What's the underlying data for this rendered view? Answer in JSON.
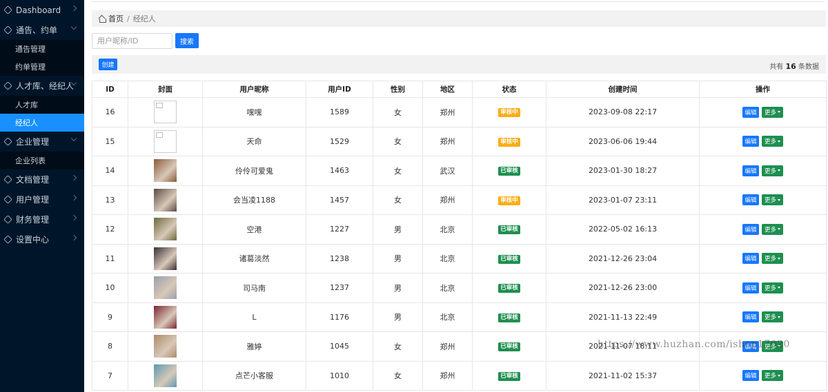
{
  "sidebar": {
    "items": [
      {
        "label": "Dashboard",
        "expanded": false,
        "children": []
      },
      {
        "label": "通告、约单",
        "expanded": true,
        "children": [
          {
            "label": "通告管理",
            "active": false
          },
          {
            "label": "约单管理",
            "active": false
          }
        ]
      },
      {
        "label": "人才库、经纪人",
        "expanded": true,
        "children": [
          {
            "label": "人才库",
            "active": false
          },
          {
            "label": "经纪人",
            "active": true
          }
        ]
      },
      {
        "label": "企业管理",
        "expanded": true,
        "children": [
          {
            "label": "企业列表",
            "active": false
          }
        ]
      },
      {
        "label": "文档管理",
        "expanded": false,
        "children": []
      },
      {
        "label": "用户管理",
        "expanded": false,
        "children": []
      },
      {
        "label": "财务管理",
        "expanded": false,
        "children": []
      },
      {
        "label": "设置中心",
        "expanded": false,
        "children": []
      }
    ]
  },
  "breadcrumb": {
    "home": "首页",
    "separator": "/",
    "current": "经纪人"
  },
  "search": {
    "placeholder": "用户昵称/ID",
    "button": "搜索"
  },
  "toolbar": {
    "create": "创建",
    "total_prefix": "共有",
    "total_count": "16",
    "total_suffix": "条数据"
  },
  "table": {
    "headers": [
      "ID",
      "封面",
      "用户昵称",
      "用户ID",
      "性别",
      "地区",
      "状态",
      "创建时间",
      "操作"
    ],
    "rows": [
      {
        "id": "16",
        "cover": "broken",
        "nickname": "嘿嘿",
        "uid": "1589",
        "gender": "女",
        "region": "郑州",
        "status": "审核中",
        "status_type": "pending",
        "created": "2023-09-08 22:17"
      },
      {
        "id": "15",
        "cover": "broken",
        "nickname": "天命",
        "uid": "1529",
        "gender": "女",
        "region": "郑州",
        "status": "审核中",
        "status_type": "pending",
        "created": "2023-06-06 19:44"
      },
      {
        "id": "14",
        "cover": "#8a5a3a",
        "nickname": "伶伶可爱鬼",
        "uid": "1463",
        "gender": "女",
        "region": "武汉",
        "status": "已审核",
        "status_type": "approved",
        "created": "2023-01-30 18:27"
      },
      {
        "id": "13",
        "cover": "#5a4a45",
        "nickname": "会当凌1188",
        "uid": "1457",
        "gender": "女",
        "region": "郑州",
        "status": "审核中",
        "status_type": "pending",
        "created": "2023-01-07 23:11"
      },
      {
        "id": "12",
        "cover": "#6a6a3a",
        "nickname": "空港",
        "uid": "1227",
        "gender": "男",
        "region": "北京",
        "status": "已审核",
        "status_type": "approved",
        "created": "2022-05-02 16:13"
      },
      {
        "id": "11",
        "cover": "#3a3035",
        "nickname": "诸葛淡然",
        "uid": "1238",
        "gender": "男",
        "region": "北京",
        "status": "已审核",
        "status_type": "approved",
        "created": "2021-12-26 23:04"
      },
      {
        "id": "10",
        "cover": "#9aa0a8",
        "nickname": "司马南",
        "uid": "1237",
        "gender": "男",
        "region": "北京",
        "status": "已审核",
        "status_type": "approved",
        "created": "2021-12-26 23:00"
      },
      {
        "id": "9",
        "cover": "#7a2530",
        "nickname": "L",
        "uid": "1176",
        "gender": "男",
        "region": "北京",
        "status": "已审核",
        "status_type": "approved",
        "created": "2021-11-13 22:49"
      },
      {
        "id": "8",
        "cover": "#b08a6a",
        "nickname": "雅婷",
        "uid": "1045",
        "gender": "女",
        "region": "郑州",
        "status": "已审核",
        "status_type": "approved",
        "created": "2021-11-07 18:11"
      },
      {
        "id": "7",
        "cover": "#5a9ab0",
        "nickname": "点芒小客服",
        "uid": "1010",
        "gender": "女",
        "region": "郑州",
        "status": "已审核",
        "status_type": "approved",
        "created": "2021-11-02 15:37"
      }
    ],
    "edit_label": "编辑",
    "more_label": "更多"
  },
  "watermark": "https://www.huzhan.com/ishop17020"
}
